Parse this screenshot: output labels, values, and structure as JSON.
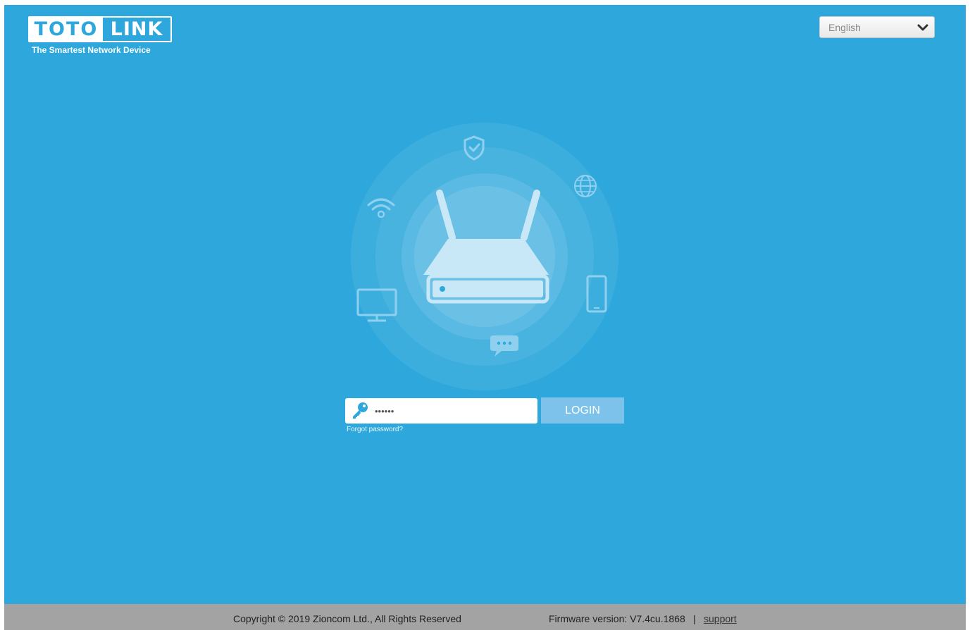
{
  "brand": {
    "logo_left": "TOTO",
    "logo_right": "LINK",
    "tagline": "The Smartest Network Device"
  },
  "language": {
    "selected": "English",
    "icon": "chevron-down-icon"
  },
  "illustration": {
    "icons": [
      "shield-check-icon",
      "globe-icon",
      "wifi-icon",
      "router-icon",
      "monitor-icon",
      "smartphone-icon",
      "chat-icon"
    ]
  },
  "login": {
    "password_value": "••••••",
    "key_icon": "key-icon",
    "button_label": "LOGIN",
    "forgot_label": "Forgot password?"
  },
  "footer": {
    "copyright": "Copyright © 2019 Zioncom Ltd., All Rights Reserved",
    "firmware": "Firmware version: V7.4cu.1868",
    "separator": "|",
    "support_label": "support"
  },
  "colors": {
    "background": "#2ea8dc",
    "button": "#7cc2ea",
    "footer": "#a3a3a3"
  }
}
